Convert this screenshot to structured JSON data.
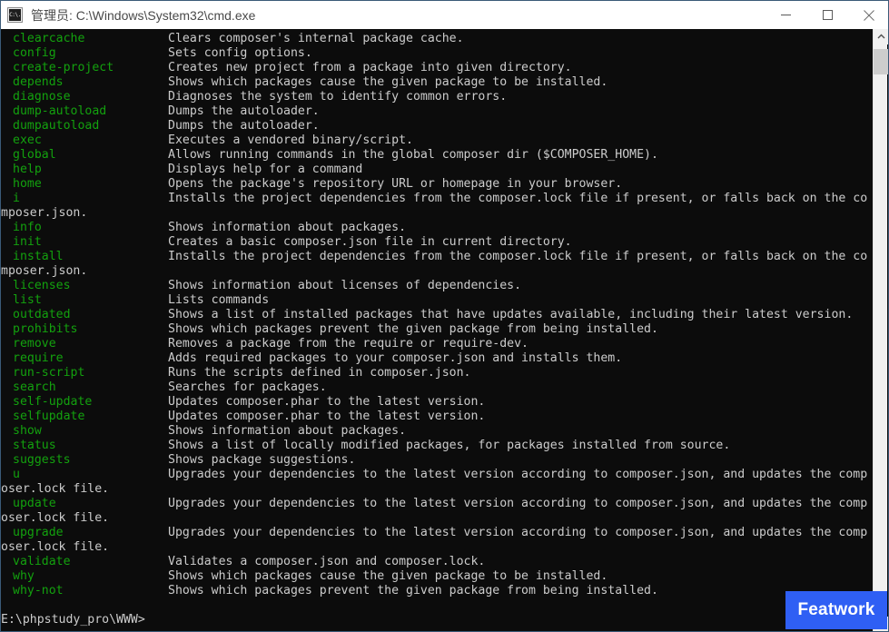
{
  "window": {
    "title": "管理员: C:\\Windows\\System32\\cmd.exe",
    "icon_label": "C:\\.",
    "controls": {
      "minimize": "minimize",
      "maximize": "maximize",
      "close": "close"
    },
    "background_color": "#0c0c0c",
    "command_color": "#13a10e",
    "text_color": "#cccccc"
  },
  "badge": {
    "label": "Featwork",
    "color": "#2f5ff4"
  },
  "scrollbar": {
    "up_arrow": "chevron-up-icon",
    "down_arrow": "chevron-down-icon"
  },
  "console": {
    "prompt": "E:\\phpstudy_pro\\WWW>",
    "lines": [
      {
        "type": "cmd",
        "command": "clearcache",
        "description": "Clears composer's internal package cache."
      },
      {
        "type": "cmd",
        "command": "config",
        "description": "Sets config options."
      },
      {
        "type": "cmd",
        "command": "create-project",
        "description": "Creates new project from a package into given directory."
      },
      {
        "type": "cmd",
        "command": "depends",
        "description": "Shows which packages cause the given package to be installed."
      },
      {
        "type": "cmd",
        "command": "diagnose",
        "description": "Diagnoses the system to identify common errors."
      },
      {
        "type": "cmd",
        "command": "dump-autoload",
        "description": "Dumps the autoloader."
      },
      {
        "type": "cmd",
        "command": "dumpautoload",
        "description": "Dumps the autoloader."
      },
      {
        "type": "cmd",
        "command": "exec",
        "description": "Executes a vendored binary/script."
      },
      {
        "type": "cmd",
        "command": "global",
        "description": "Allows running commands in the global composer dir ($COMPOSER_HOME)."
      },
      {
        "type": "cmd",
        "command": "help",
        "description": "Displays help for a command"
      },
      {
        "type": "cmd",
        "command": "home",
        "description": "Opens the package's repository URL or homepage in your browser."
      },
      {
        "type": "cmd",
        "command": "i",
        "description": "Installs the project dependencies from the composer.lock file if present, or falls back on the co"
      },
      {
        "type": "wrap",
        "text": "mposer.json."
      },
      {
        "type": "cmd",
        "command": "info",
        "description": "Shows information about packages."
      },
      {
        "type": "cmd",
        "command": "init",
        "description": "Creates a basic composer.json file in current directory."
      },
      {
        "type": "cmd",
        "command": "install",
        "description": "Installs the project dependencies from the composer.lock file if present, or falls back on the co"
      },
      {
        "type": "wrap",
        "text": "mposer.json."
      },
      {
        "type": "cmd",
        "command": "licenses",
        "description": "Shows information about licenses of dependencies."
      },
      {
        "type": "cmd",
        "command": "list",
        "description": "Lists commands"
      },
      {
        "type": "cmd",
        "command": "outdated",
        "description": "Shows a list of installed packages that have updates available, including their latest version."
      },
      {
        "type": "cmd",
        "command": "prohibits",
        "description": "Shows which packages prevent the given package from being installed."
      },
      {
        "type": "cmd",
        "command": "remove",
        "description": "Removes a package from the require or require-dev."
      },
      {
        "type": "cmd",
        "command": "require",
        "description": "Adds required packages to your composer.json and installs them."
      },
      {
        "type": "cmd",
        "command": "run-script",
        "description": "Runs the scripts defined in composer.json."
      },
      {
        "type": "cmd",
        "command": "search",
        "description": "Searches for packages."
      },
      {
        "type": "cmd",
        "command": "self-update",
        "description": "Updates composer.phar to the latest version."
      },
      {
        "type": "cmd",
        "command": "selfupdate",
        "description": "Updates composer.phar to the latest version."
      },
      {
        "type": "cmd",
        "command": "show",
        "description": "Shows information about packages."
      },
      {
        "type": "cmd",
        "command": "status",
        "description": "Shows a list of locally modified packages, for packages installed from source."
      },
      {
        "type": "cmd",
        "command": "suggests",
        "description": "Shows package suggestions."
      },
      {
        "type": "cmd",
        "command": "u",
        "description": "Upgrades your dependencies to the latest version according to composer.json, and updates the comp"
      },
      {
        "type": "wrap",
        "text": "oser.lock file."
      },
      {
        "type": "cmd",
        "command": "update",
        "description": "Upgrades your dependencies to the latest version according to composer.json, and updates the comp"
      },
      {
        "type": "wrap",
        "text": "oser.lock file."
      },
      {
        "type": "cmd",
        "command": "upgrade",
        "description": "Upgrades your dependencies to the latest version according to composer.json, and updates the comp"
      },
      {
        "type": "wrap",
        "text": "oser.lock file."
      },
      {
        "type": "cmd",
        "command": "validate",
        "description": "Validates a composer.json and composer.lock."
      },
      {
        "type": "cmd",
        "command": "why",
        "description": "Shows which packages cause the given package to be installed."
      },
      {
        "type": "cmd",
        "command": "why-not",
        "description": "Shows which packages prevent the given package from being installed."
      },
      {
        "type": "blank",
        "text": ""
      }
    ]
  }
}
